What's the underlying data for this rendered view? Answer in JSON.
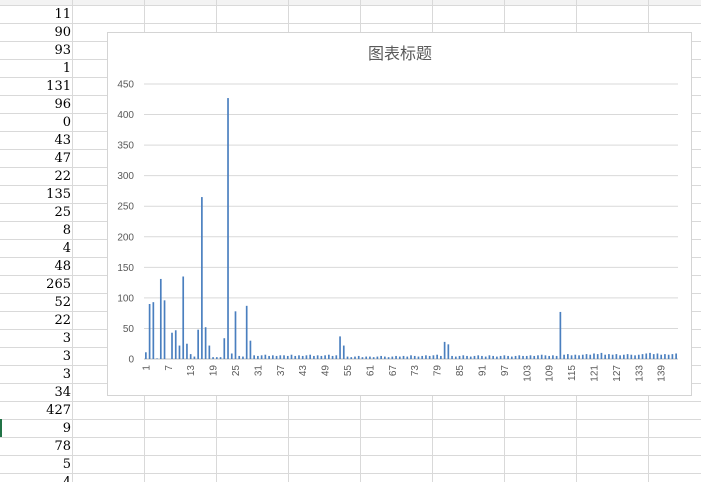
{
  "sheet": {
    "column_a_values": [
      "11",
      "90",
      "93",
      "1",
      "131",
      "96",
      "0",
      "43",
      "47",
      "22",
      "135",
      "25",
      "8",
      "4",
      "48",
      "265",
      "52",
      "22",
      "3",
      "3",
      "3",
      "34",
      "427",
      "9",
      "78",
      "5",
      "4"
    ]
  },
  "chart_data": {
    "type": "bar",
    "title": "图表标题",
    "xlabel": "",
    "ylabel": "",
    "ylim": [
      0,
      450
    ],
    "yticks": [
      0,
      50,
      100,
      150,
      200,
      250,
      300,
      350,
      400,
      450
    ],
    "xtick_labels": [
      "1",
      "7",
      "13",
      "19",
      "25",
      "31",
      "37",
      "43",
      "49",
      "55",
      "61",
      "67",
      "73",
      "79",
      "85",
      "91",
      "97",
      "103",
      "109",
      "115",
      "121",
      "127",
      "133",
      "139"
    ],
    "grid": true,
    "legend": "none",
    "bar_color": "#4a7fbf",
    "x": [
      1,
      2,
      3,
      4,
      5,
      6,
      7,
      8,
      9,
      10,
      11,
      12,
      13,
      14,
      15,
      16,
      17,
      18,
      19,
      20,
      21,
      22,
      23,
      24,
      25,
      26,
      27,
      28,
      29,
      30,
      31,
      32,
      33,
      34,
      35,
      36,
      37,
      38,
      39,
      40,
      41,
      42,
      43,
      44,
      45,
      46,
      47,
      48,
      49,
      50,
      51,
      52,
      53,
      54,
      55,
      56,
      57,
      58,
      59,
      60,
      61,
      62,
      63,
      64,
      65,
      66,
      67,
      68,
      69,
      70,
      71,
      72,
      73,
      74,
      75,
      76,
      77,
      78,
      79,
      80,
      81,
      82,
      83,
      84,
      85,
      86,
      87,
      88,
      89,
      90,
      91,
      92,
      93,
      94,
      95,
      96,
      97,
      98,
      99,
      100,
      101,
      102,
      103,
      104,
      105,
      106,
      107,
      108,
      109,
      110,
      111,
      112,
      113,
      114,
      115,
      116,
      117,
      118,
      119,
      120,
      121,
      122,
      123,
      124,
      125,
      126,
      127,
      128,
      129,
      130,
      131,
      132,
      133,
      134,
      135,
      136,
      137,
      138,
      139,
      140,
      141,
      142,
      143
    ],
    "values": [
      11,
      90,
      93,
      1,
      131,
      96,
      0,
      43,
      47,
      22,
      135,
      25,
      8,
      4,
      48,
      265,
      52,
      22,
      3,
      3,
      3,
      34,
      427,
      9,
      78,
      5,
      4,
      87,
      30,
      6,
      5,
      6,
      7,
      5,
      6,
      5,
      6,
      6,
      5,
      7,
      5,
      6,
      5,
      6,
      7,
      5,
      6,
      5,
      6,
      7,
      5,
      6,
      37,
      22,
      4,
      3,
      4,
      5,
      3,
      4,
      4,
      3,
      4,
      5,
      4,
      3,
      4,
      5,
      4,
      5,
      4,
      6,
      5,
      4,
      5,
      6,
      5,
      6,
      7,
      5,
      28,
      24,
      5,
      4,
      5,
      6,
      5,
      4,
      5,
      6,
      5,
      4,
      6,
      5,
      4,
      5,
      6,
      5,
      4,
      5,
      6,
      5,
      5,
      6,
      5,
      6,
      7,
      6,
      5,
      6,
      5,
      77,
      7,
      8,
      6,
      7,
      6,
      7,
      8,
      7,
      9,
      8,
      10,
      7,
      8,
      7,
      8,
      6,
      7,
      8,
      7,
      6,
      7,
      8,
      9,
      10,
      8,
      9,
      7,
      8,
      7,
      8,
      9
    ]
  }
}
